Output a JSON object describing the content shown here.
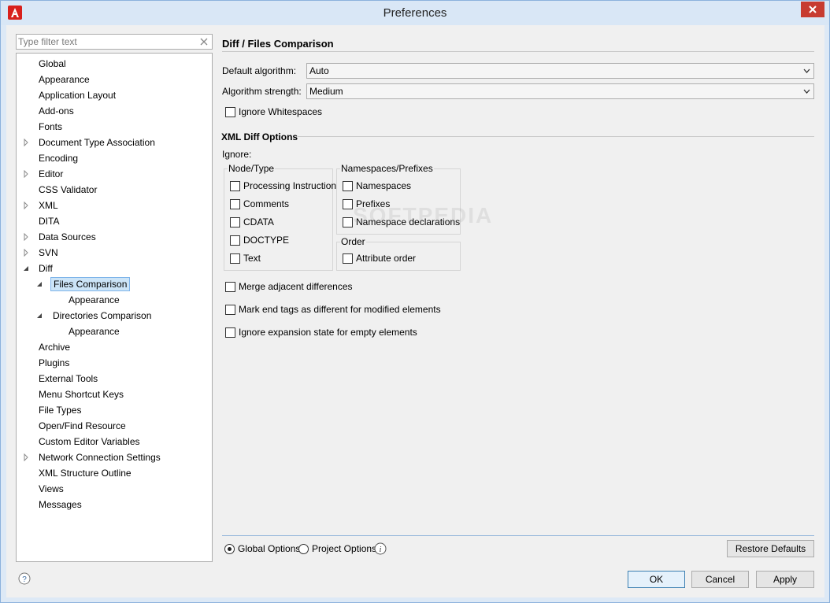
{
  "window": {
    "title": "Preferences"
  },
  "filter": {
    "placeholder": "Type filter text"
  },
  "tree": [
    {
      "label": "Global",
      "level": 0,
      "expander": "none"
    },
    {
      "label": "Appearance",
      "level": 0,
      "expander": "none"
    },
    {
      "label": "Application Layout",
      "level": 0,
      "expander": "none"
    },
    {
      "label": "Add-ons",
      "level": 0,
      "expander": "none"
    },
    {
      "label": "Fonts",
      "level": 0,
      "expander": "none"
    },
    {
      "label": "Document Type Association",
      "level": 0,
      "expander": "collapsed"
    },
    {
      "label": "Encoding",
      "level": 0,
      "expander": "none"
    },
    {
      "label": "Editor",
      "level": 0,
      "expander": "collapsed"
    },
    {
      "label": "CSS Validator",
      "level": 0,
      "expander": "none"
    },
    {
      "label": "XML",
      "level": 0,
      "expander": "collapsed"
    },
    {
      "label": "DITA",
      "level": 0,
      "expander": "none"
    },
    {
      "label": "Data Sources",
      "level": 0,
      "expander": "collapsed"
    },
    {
      "label": "SVN",
      "level": 0,
      "expander": "collapsed"
    },
    {
      "label": "Diff",
      "level": 0,
      "expander": "expanded"
    },
    {
      "label": "Files Comparison",
      "level": 1,
      "expander": "expanded",
      "selected": true
    },
    {
      "label": "Appearance",
      "level": 2,
      "expander": "none"
    },
    {
      "label": "Directories Comparison",
      "level": 1,
      "expander": "expanded"
    },
    {
      "label": "Appearance",
      "level": 2,
      "expander": "none"
    },
    {
      "label": "Archive",
      "level": 0,
      "expander": "none"
    },
    {
      "label": "Plugins",
      "level": 0,
      "expander": "none"
    },
    {
      "label": "External Tools",
      "level": 0,
      "expander": "none"
    },
    {
      "label": "Menu Shortcut Keys",
      "level": 0,
      "expander": "none"
    },
    {
      "label": "File Types",
      "level": 0,
      "expander": "none"
    },
    {
      "label": "Open/Find Resource",
      "level": 0,
      "expander": "none"
    },
    {
      "label": "Custom Editor Variables",
      "level": 0,
      "expander": "none"
    },
    {
      "label": "Network Connection Settings",
      "level": 0,
      "expander": "collapsed"
    },
    {
      "label": "XML Structure Outline",
      "level": 0,
      "expander": "none"
    },
    {
      "label": "Views",
      "level": 0,
      "expander": "none"
    },
    {
      "label": "Messages",
      "level": 0,
      "expander": "none"
    }
  ],
  "page": {
    "title": "Diff / Files Comparison",
    "default_algorithm_label": "Default algorithm:",
    "default_algorithm_value": "Auto",
    "algorithm_strength_label": "Algorithm strength:",
    "algorithm_strength_value": "Medium",
    "ignore_whitespaces": "Ignore Whitespaces",
    "xml_section_title": "XML Diff Options",
    "ignore_label": "Ignore:",
    "node_type_group": {
      "title": "Node/Type",
      "items": [
        "Processing Instruction",
        "Comments",
        "CDATA",
        "DOCTYPE",
        "Text"
      ]
    },
    "namespaces_group": {
      "title": "Namespaces/Prefixes",
      "items": [
        "Namespaces",
        "Prefixes",
        "Namespace declarations"
      ]
    },
    "order_group": {
      "title": "Order",
      "items": [
        "Attribute order"
      ]
    },
    "merge_adjacent": "Merge adjacent differences",
    "mark_end_tags": "Mark end tags as different for modified elements",
    "ignore_expansion": "Ignore expansion state for empty elements",
    "watermark": "SOFTPEDIA"
  },
  "options": {
    "global_options": "Global Options",
    "project_options": "Project Options",
    "selected": "global",
    "restore_defaults": "Restore Defaults"
  },
  "buttons": {
    "ok": "OK",
    "cancel": "Cancel",
    "apply": "Apply"
  },
  "colors": {
    "accent": "#3c7fb1",
    "selection": "#cce4f7",
    "app_icon": "#d8201c",
    "close": "#c73b30"
  }
}
